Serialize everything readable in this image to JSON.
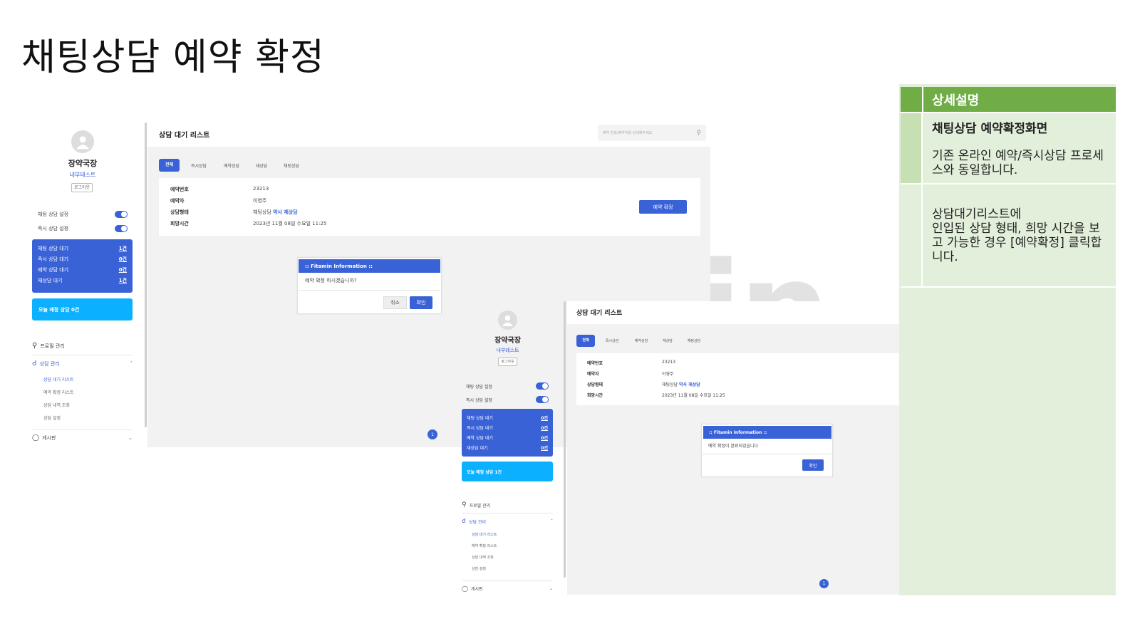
{
  "page": {
    "title": "채팅상담 예약 확정"
  },
  "watermark": "Fitamin",
  "sidebar": {
    "name": "장약국장",
    "team": "내부테스트",
    "logout": "로그아웃",
    "toggles": [
      {
        "label": "채팅 상담 설정",
        "on": true
      },
      {
        "label": "즉시 상담 설정",
        "on": true
      }
    ],
    "counts_before": [
      {
        "label": "채팅 상담 대기",
        "value": "1건"
      },
      {
        "label": "즉시 상담 대기",
        "value": "0건"
      },
      {
        "label": "예약 상담 대기",
        "value": "0건"
      },
      {
        "label": "재상담 대기",
        "value": "1건"
      }
    ],
    "counts_after": [
      {
        "label": "채팅 상담 대기",
        "value": "0건"
      },
      {
        "label": "즉시 상담 대기",
        "value": "0건"
      },
      {
        "label": "예약 상담 대기",
        "value": "0건"
      },
      {
        "label": "재상담 대기",
        "value": "0건"
      }
    ],
    "today_before": "오늘 예정 상담 0건",
    "today_after": "오늘 예정 상담 1건",
    "menu": {
      "profile": "프로필 관리",
      "consult": "상담 관리",
      "sub": [
        "상담 대기 리스트",
        "예약 확정 리스트",
        "상담 내역 조회",
        "상담 설정"
      ],
      "board": "게시판"
    }
  },
  "main": {
    "title": "상담 대기 리스트",
    "search_placeholder": "예약 번호/예약자를 검색해주세요.",
    "tabs": [
      "전체",
      "즉시상담",
      "예약상담",
      "재상담",
      "채팅상담"
    ],
    "fields": [
      {
        "key": "예약번호",
        "value": "23213"
      },
      {
        "key": "예약자",
        "value": "이영주"
      },
      {
        "key": "상담형태",
        "value": "채팅상담",
        "highlight": "약사 재상담"
      },
      {
        "key": "희망시간",
        "value": "2023년 11월 08일 수요일 11:25"
      }
    ],
    "confirm_button": "예약 확정",
    "page_number": "1"
  },
  "dialog_confirm": {
    "title": ":: Fitamin Information ::",
    "message": "예약 확정 하시겠습니까?",
    "cancel": "취소",
    "ok": "확인"
  },
  "dialog_done": {
    "title": ":: Fitamin Information ::",
    "message": "예약 확정이 완료되었습니다",
    "ok": "확인"
  },
  "description": {
    "header": "상세설명",
    "row1_title": "채팅상담 예약확정화면",
    "row1_body": "기존 온라인 예약/즉시상담 프로세스와 동일합니다.",
    "row2_body": "상담대기리스트에\n인입된 상담 형태, 희망 시간을 보고 가능한 경우 [예약확정] 클릭합니다."
  },
  "colors": {
    "accent": "#3a62d7",
    "today": "#0bb0ff",
    "desc_header": "#70ad47"
  }
}
